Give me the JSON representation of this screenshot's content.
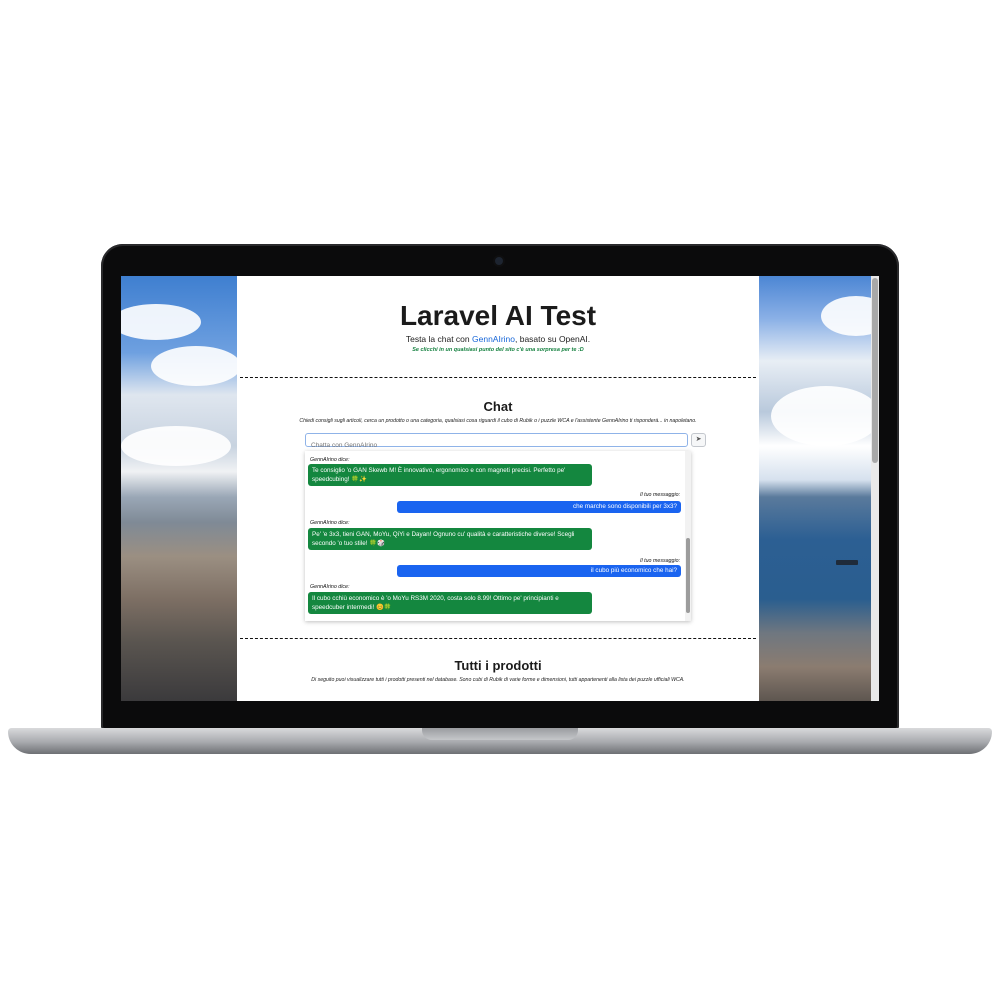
{
  "page": {
    "title": "Laravel AI Test",
    "subtitle_prefix": "Testa la chat con ",
    "subtitle_link": "GennAIrino",
    "subtitle_suffix": ", basato su OpenAI.",
    "easter_egg": "Se clicchi in un qualsiasi punto del sito c'è una sorpresa per te :D"
  },
  "chat": {
    "title": "Chat",
    "description": "Chiedi consigli sugli articoli, cerca un prodotto o una categoria, qualsiasi cosa riguardi il cubo di Rubik o i puzzle WCA e l'assistente GennAIrino ti risponderà... in napoletano.",
    "input_placeholder": "Chatta con GennAIrino",
    "send_icon": "send-icon",
    "messages": [
      {
        "role": "ai",
        "label": "GennAIrino dice:",
        "text": "Te consiglio 'o GAN Skewb M! È innovativo, ergonomico e con magneti precisi. Perfetto pe' speedcubing! 🍀✨"
      },
      {
        "role": "user",
        "label": "Il tuo messaggio:",
        "text": "che marche sono disponibili per 3x3?"
      },
      {
        "role": "ai",
        "label": "GennAIrino dice:",
        "text": "Pe' 'e 3x3, tieni GAN, MoYu, QiYi e Dayan! Ognuno cu' qualità e caratteristiche diverse! Scegli secondo 'o tuo stile! 🍀🎲"
      },
      {
        "role": "user",
        "label": "Il tuo messaggio:",
        "text": "il cubo più economico che hai?"
      },
      {
        "role": "ai",
        "label": "GennAIrino dice:",
        "text": "Il cubo cchiù economico è 'o MoYu RS3M 2020, costa solo 8.99! Ottimo pe' principianti e speedcuber intermedi! 😊🍀"
      }
    ]
  },
  "products": {
    "title": "Tutti i prodotti",
    "description": "Di seguito puoi visualizzare tutti i prodotti presenti nel database. Sono cubi di Rubik di varie forme e dimensioni, tutti appartenenti alla lista dei puzzle ufficiali WCA."
  },
  "colors": {
    "ai_bubble": "#14873f",
    "user_bubble": "#1a64f0",
    "link": "#1766d8",
    "easter_egg": "#14803f"
  }
}
